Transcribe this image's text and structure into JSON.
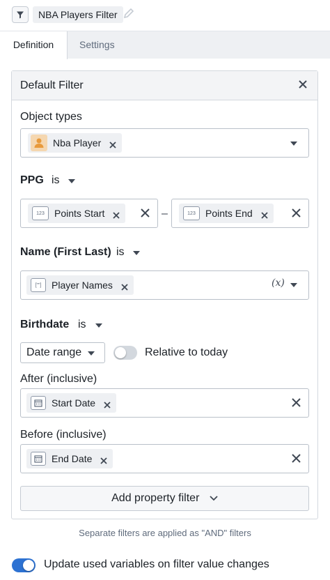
{
  "header": {
    "filter_title": "NBA Players Filter",
    "type_icon": "filter-icon",
    "edit_icon": "pencil-icon"
  },
  "tabs": [
    {
      "label": "Definition",
      "active": true
    },
    {
      "label": "Settings",
      "active": false
    }
  ],
  "panel": {
    "title": "Default Filter",
    "close_icon": "close-icon",
    "object_types": {
      "label": "Object types",
      "selected": "Nba Player",
      "icon": "person-icon"
    },
    "ppg": {
      "label": "PPG",
      "operator": "is",
      "start": {
        "icon_text": "123",
        "label": "Points Start"
      },
      "separator": "–",
      "end": {
        "icon_text": "123",
        "label": "Points End"
      }
    },
    "name": {
      "label": "Name (First Last)",
      "operator": "is",
      "value": {
        "icon_text": "[\"\"]",
        "label": "Player Names"
      },
      "variable_symbol": "(x)"
    },
    "birthdate": {
      "label": "Birthdate",
      "operator": "is",
      "mode": "Date range",
      "relative_label": "Relative to today",
      "relative_enabled": false,
      "after_label": "After (inclusive)",
      "after_value": "Start Date",
      "before_label": "Before (inclusive)",
      "before_value": "End Date"
    },
    "add_button": "Add property filter"
  },
  "footer": {
    "note": "Separate filters are applied as \"AND\" filters",
    "update_label": "Update used variables on filter value changes",
    "update_enabled": true
  },
  "colors": {
    "accent": "#2d72d2",
    "toggle_off": "#d3d8de",
    "chip_bg": "#eef0f3",
    "person_icon": "#e89a3c"
  }
}
